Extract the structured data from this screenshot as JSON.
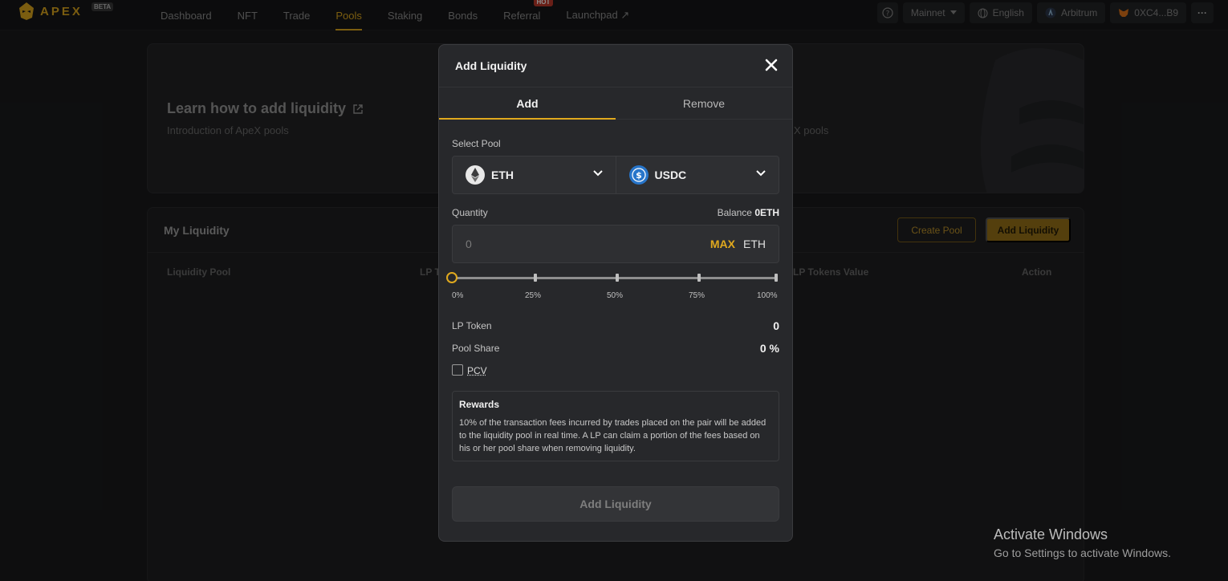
{
  "nav": {
    "logo_text": "APEX",
    "beta": "BETA",
    "links": [
      {
        "label": "Dashboard"
      },
      {
        "label": "NFT"
      },
      {
        "label": "Trade"
      },
      {
        "label": "Pools"
      },
      {
        "label": "Staking"
      },
      {
        "label": "Bonds"
      },
      {
        "label": "Referral",
        "badge": "HOT"
      },
      {
        "label": "Launchpad ↗"
      }
    ],
    "active": "Pools",
    "network": "Mainnet",
    "language": "English",
    "chain": "Arbitrum",
    "wallet": "0XC4...B9",
    "more": "···"
  },
  "learn": {
    "title": "Learn how to add liquidity",
    "subtitle": "Introduction of ApeX pools",
    "subtitle_partial": "X pools"
  },
  "my_liquidity": {
    "title": "My Liquidity",
    "create_pool": "Create Pool",
    "add_liquidity": "Add Liquidity",
    "columns": [
      "Liquidity Pool",
      "LP T",
      "LP Tokens Value",
      "Action"
    ]
  },
  "modal": {
    "title": "Add Liquidity",
    "tabs": [
      "Add",
      "Remove"
    ],
    "select_pool_label": "Select Pool",
    "base_token": "ETH",
    "quote_token": "USDC",
    "quantity_label": "Quantity",
    "balance_label": "Balance",
    "balance_value": "0ETH",
    "quantity_placeholder": "0",
    "max_label": "MAX",
    "quantity_unit": "ETH",
    "slider_value_percent": 0,
    "slider_marks": [
      "0%",
      "25%",
      "50%",
      "75%",
      "100%"
    ],
    "lp_token_label": "LP Token",
    "lp_token_value": "0",
    "pool_share_label": "Pool Share",
    "pool_share_value": "0 %",
    "pcv_label": "PCV",
    "rewards_title": "Rewards",
    "rewards_text": "10% of the transaction fees incurred by trades placed on the pair will be added to the liquidity pool in real time. A LP can claim a portion of the fees based on his or her pool share when removing liquidity.",
    "submit_label": "Add Liquidity"
  },
  "watermark": {
    "title": "Activate Windows",
    "subtitle": "Go to Settings to activate Windows."
  },
  "colors": {
    "accent": "#e0a91e",
    "background": "#1a1b1d",
    "modal": "#27282b"
  }
}
